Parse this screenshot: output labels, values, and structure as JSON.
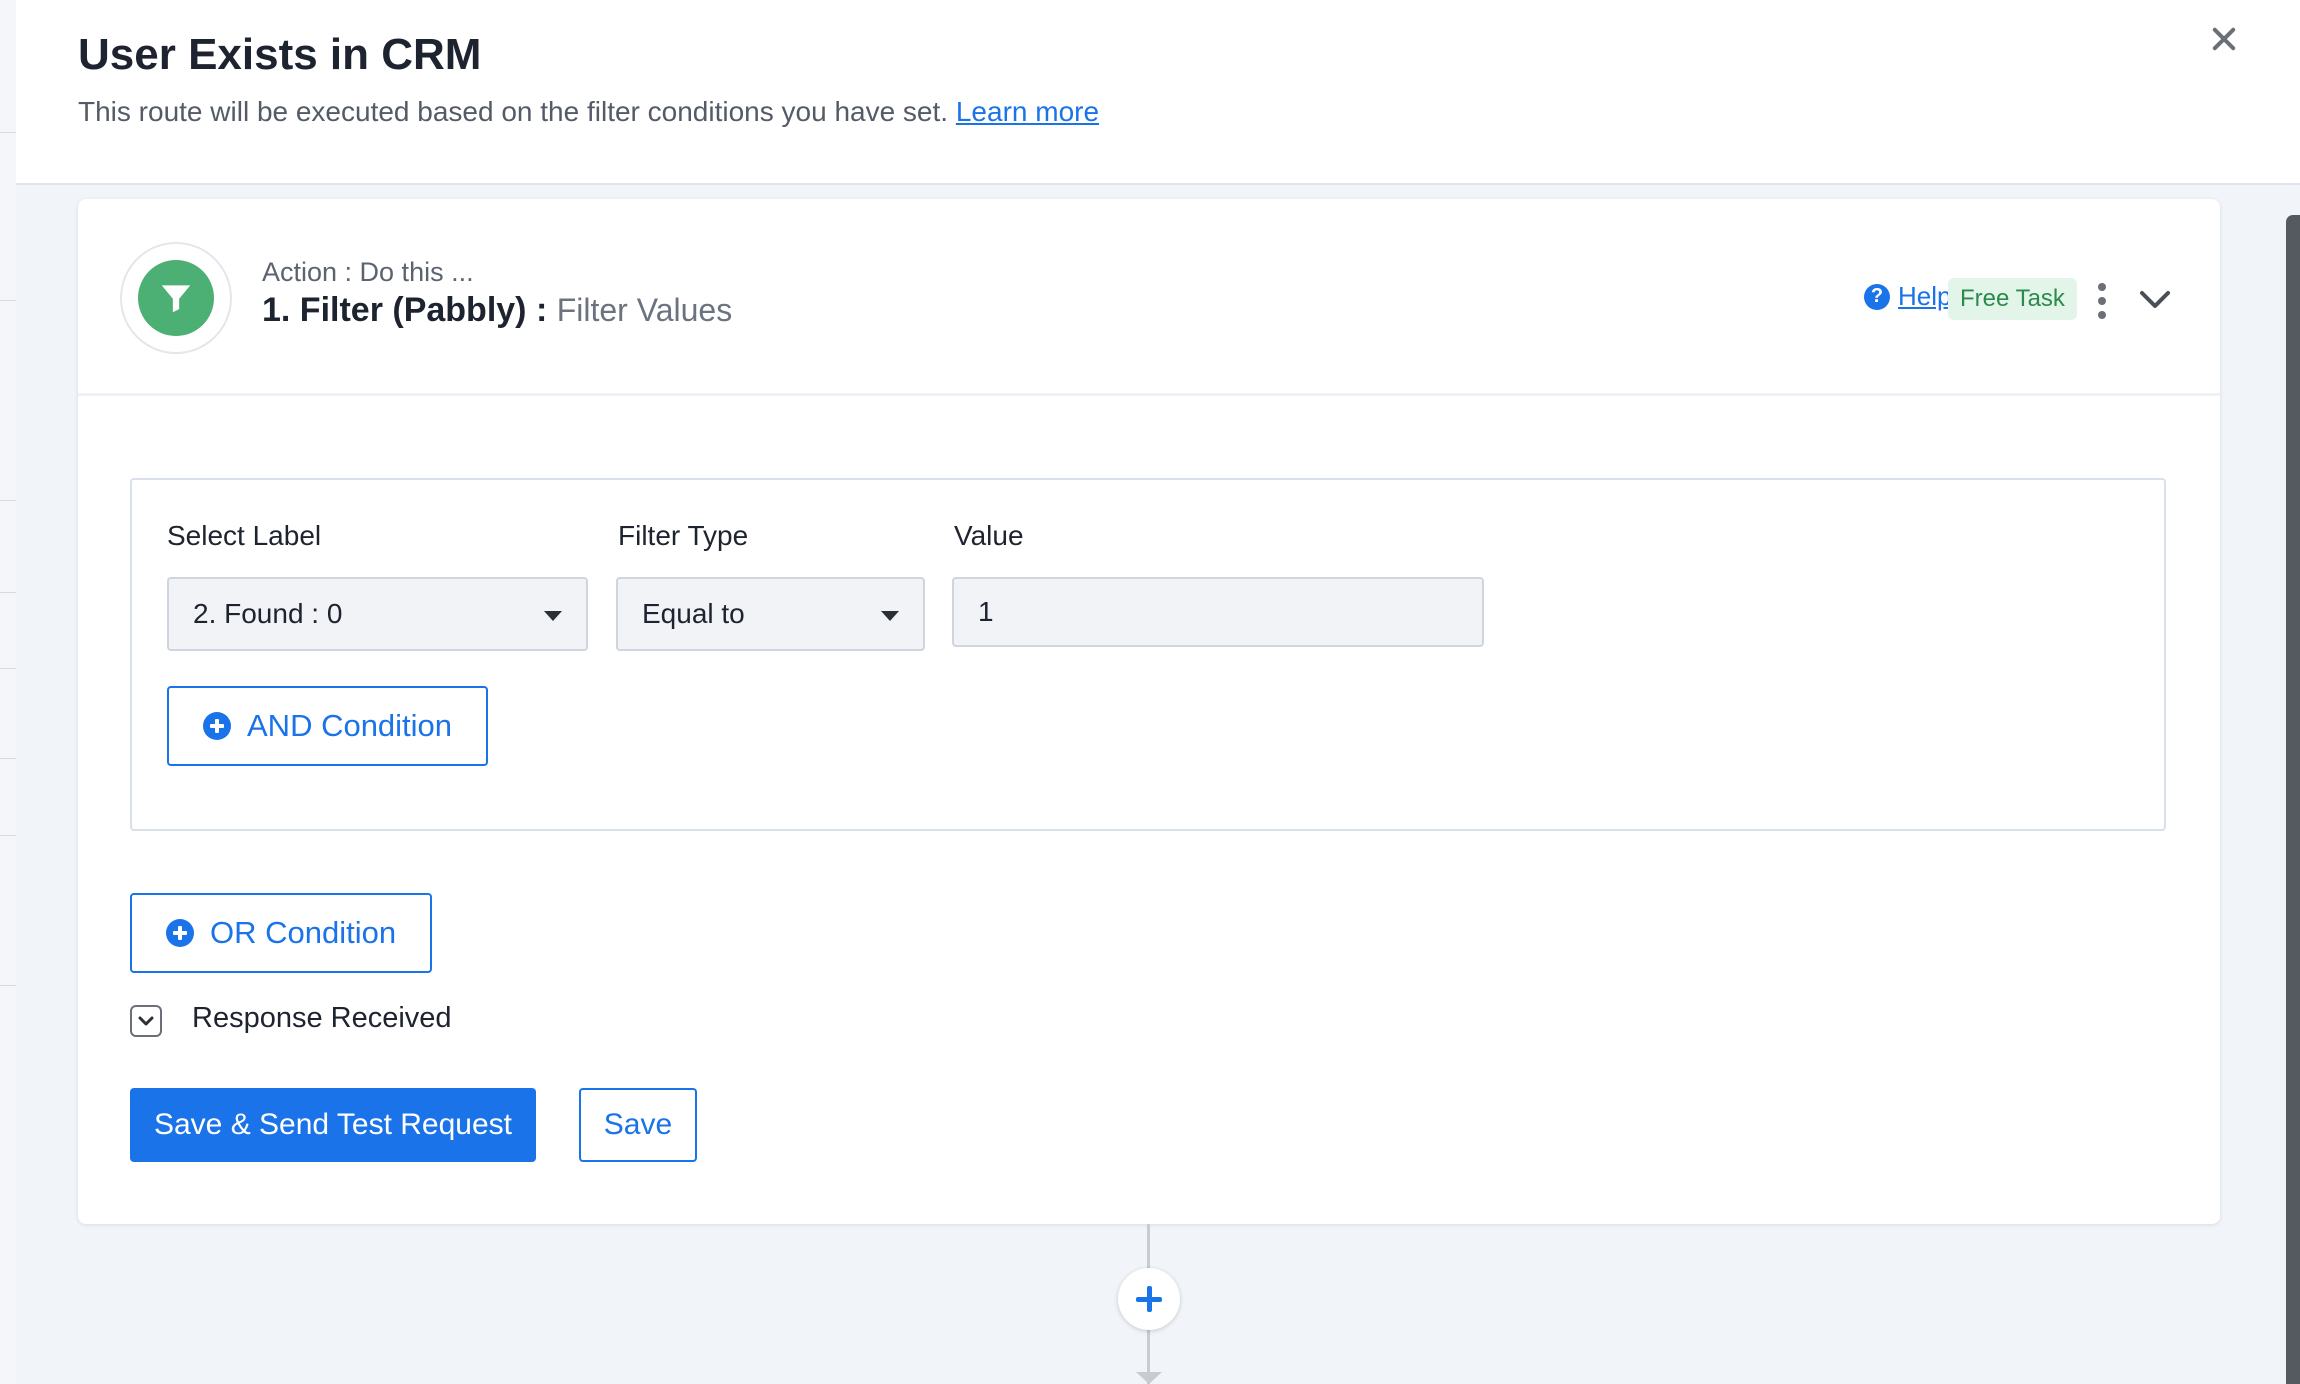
{
  "modal": {
    "title": "User Exists in CRM",
    "subtitle": "This route will be executed based on the filter conditions you have set.",
    "learn_more": "Learn more"
  },
  "step": {
    "action_label": "Action : Do this ...",
    "title": "1. Filter (Pabbly) :",
    "subtitle": "Filter Values",
    "app_icon": "filter-icon",
    "help_label": "Help",
    "badge": "Free Task"
  },
  "filter": {
    "label_header": "Select Label",
    "type_header": "Filter Type",
    "value_header": "Value",
    "label_value": "2. Found : 0",
    "type_value": "Equal to",
    "value_value": "1",
    "and_condition": "AND Condition"
  },
  "or_condition": "OR Condition",
  "response_received": "Response Received",
  "buttons": {
    "save_send": "Save & Send Test Request",
    "save": "Save"
  },
  "colors": {
    "accent": "#1a73e8",
    "app_icon_bg": "#4caf73",
    "badge_bg": "#e2f5e8",
    "badge_text": "#2d8a4e"
  }
}
